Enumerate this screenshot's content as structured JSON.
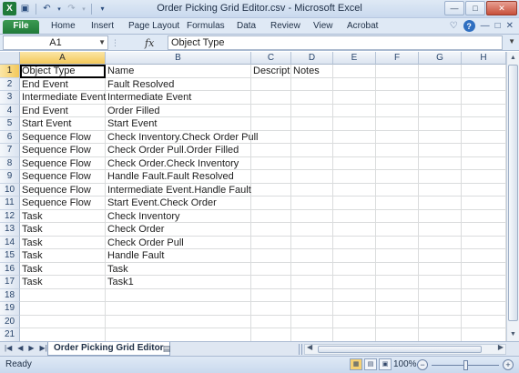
{
  "window": {
    "title": "Order Picking Grid Editor.csv  -  Microsoft Excel",
    "icons": [
      "excel-icon",
      "save-icon",
      "undo-icon",
      "redo-icon",
      "customize-icon"
    ]
  },
  "ribbon": {
    "tabs": [
      {
        "label": "File",
        "name": "tab-file"
      },
      {
        "label": "Home",
        "name": "tab-home"
      },
      {
        "label": "Insert",
        "name": "tab-insert"
      },
      {
        "label": "Page Layout",
        "name": "tab-page-layout"
      },
      {
        "label": "Formulas",
        "name": "tab-formulas"
      },
      {
        "label": "Data",
        "name": "tab-data"
      },
      {
        "label": "Review",
        "name": "tab-review"
      },
      {
        "label": "View",
        "name": "tab-view"
      },
      {
        "label": "Acrobat",
        "name": "tab-acrobat"
      }
    ]
  },
  "formula_bar": {
    "name_box": "A1",
    "fx": "fx",
    "content": "Object Type"
  },
  "grid": {
    "columns": [
      "A",
      "B",
      "C",
      "D",
      "E",
      "F",
      "G",
      "H"
    ],
    "selected_column": "A",
    "selected_row": 1,
    "rows": [
      [
        "Object Type",
        "Name",
        "Descriptic",
        "Notes"
      ],
      [
        "End Event",
        "Fault Resolved",
        "",
        ""
      ],
      [
        "Intermediate Event",
        "Intermediate Event",
        "",
        ""
      ],
      [
        "End Event",
        "Order Filled",
        "",
        ""
      ],
      [
        "Start Event",
        "Start Event",
        "",
        ""
      ],
      [
        "Sequence Flow",
        "Check Inventory.Check Order Pull",
        "",
        ""
      ],
      [
        "Sequence Flow",
        "Check Order Pull.Order Filled",
        "",
        ""
      ],
      [
        "Sequence Flow",
        "Check Order.Check Inventory",
        "",
        ""
      ],
      [
        "Sequence Flow",
        "Handle Fault.Fault Resolved",
        "",
        ""
      ],
      [
        "Sequence Flow",
        "Intermediate Event.Handle Fault",
        "",
        ""
      ],
      [
        "Sequence Flow",
        "Start Event.Check Order",
        "",
        ""
      ],
      [
        "Task",
        "Check Inventory",
        "",
        ""
      ],
      [
        "Task",
        "Check Order",
        "",
        ""
      ],
      [
        "Task",
        "Check Order Pull",
        "",
        ""
      ],
      [
        "Task",
        "Handle Fault",
        "",
        ""
      ],
      [
        "Task",
        "Task",
        "",
        ""
      ],
      [
        "Task",
        "Task1",
        "",
        ""
      ],
      [
        "",
        "",
        "",
        ""
      ],
      [
        "",
        "",
        "",
        ""
      ],
      [
        "",
        "",
        "",
        ""
      ],
      [
        "",
        "",
        "",
        ""
      ]
    ]
  },
  "sheets": {
    "active": "Order Picking Grid Editor"
  },
  "status": {
    "text": "Ready",
    "zoom": "100%",
    "zoom_minus": "−",
    "zoom_plus": "+"
  }
}
